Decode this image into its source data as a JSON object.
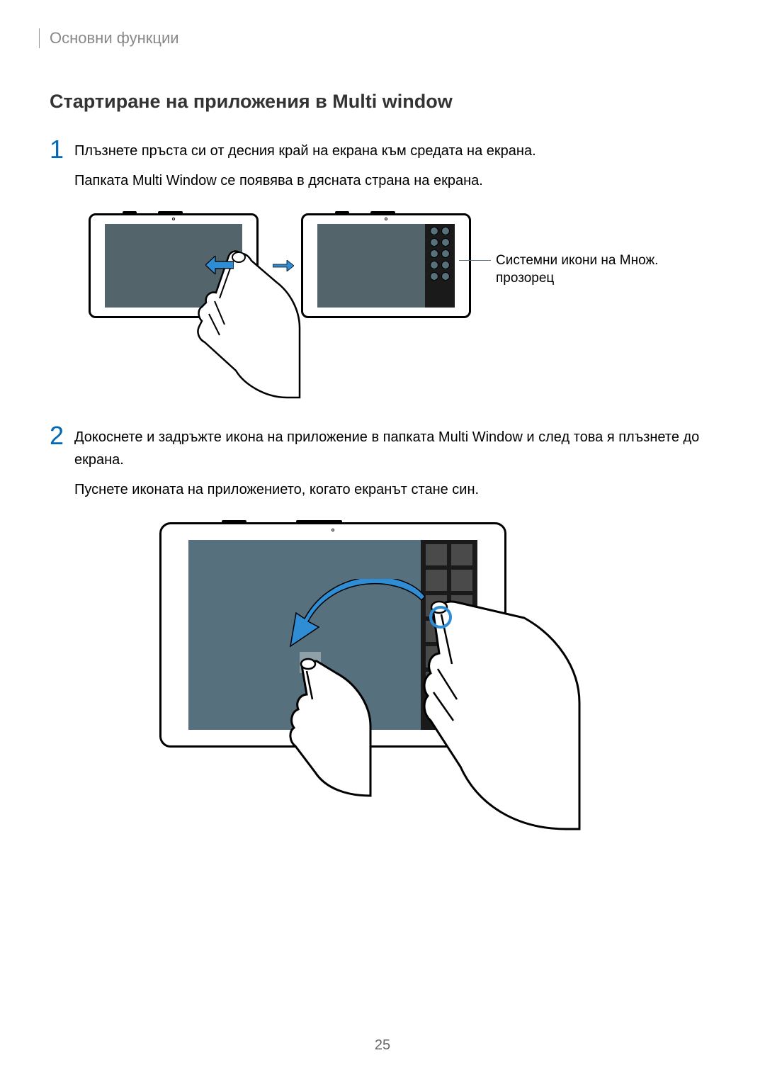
{
  "breadcrumb": "Основни функции",
  "section_title": "Стартиране на приложения в Multi window",
  "steps": [
    {
      "number": "1",
      "text1": "Плъзнете пръста си от десния край на екрана към средата на екрана.",
      "text2": "Папката Multi Window се появява в дясната страна на екрана."
    },
    {
      "number": "2",
      "text1": "Докоснете и задръжте икона на приложение в папката Multi Window и след това я плъзнете до екрана.",
      "text2": "Пуснете иконата на приложението, когато екранът стане син."
    }
  ],
  "callout": "Системни икони на Множ. прозорец",
  "page_number": "25"
}
